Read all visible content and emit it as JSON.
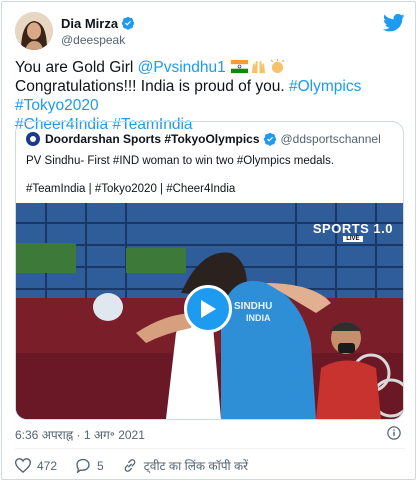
{
  "author": {
    "name": "Dia Mirza",
    "handle": "@deespeak"
  },
  "tweet": {
    "text_a": "You are Gold Girl ",
    "mention": "@Pvsindhu1",
    "text_b": " Congratulations!!! India is proud of you. ",
    "hashtags_1": "#Olympics #Tokyo2020",
    "hashtags_2": "#Cheer4India #TeamIndia"
  },
  "quoted": {
    "name": "Doordarshan Sports #TokyoOlympics",
    "handle": "@ddsportschannel",
    "line1": "PV Sindhu- First #IND woman to win two #Olympics medals.",
    "line2": "#TeamIndia | #Tokyo2020 | #Cheer4India",
    "video": {
      "channel_logo": "SPORTS 1.0",
      "live": "LIVE",
      "jersey_1": "SINDHU",
      "jersey_2": "INDIA"
    }
  },
  "meta": {
    "time": "6:36 अपराह्न · 1 अग॰ 2021"
  },
  "actions": {
    "likes": "472",
    "replies": "5",
    "copy_link": "ट्वीट का लिंक कॉपी करें"
  },
  "icons": [
    "verified-badge-icon",
    "twitter-bird-icon",
    "play-icon",
    "info-icon",
    "heart-icon",
    "reply-icon",
    "link-icon"
  ],
  "colors": {
    "link": "#1d9bf0",
    "secondary_text": "#536471",
    "border": "#cfd9de"
  }
}
